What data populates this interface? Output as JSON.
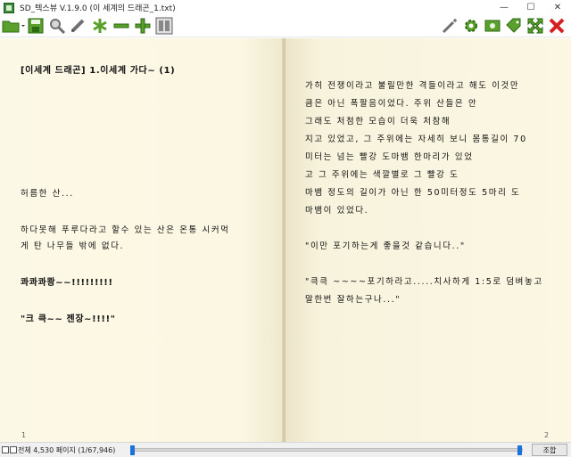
{
  "window": {
    "title": "SD_텍스뷰 V.1.9.0 (이 세계의 드래곤_1.txt)",
    "minimize": "—",
    "maximize": "☐",
    "close": "✕"
  },
  "toolbar": {
    "icons": [
      "open-folder-icon",
      "save-icon",
      "search-icon",
      "pencil-icon",
      "asterisk-icon",
      "minus-icon",
      "plus-icon",
      "two-page-icon",
      "magic-wand-icon",
      "gear-icon",
      "image-icon",
      "tag-icon",
      "fullscreen-icon",
      "exit-icon"
    ],
    "colors": {
      "green": "#5aa02c",
      "gray": "#707070",
      "red": "#d42020"
    }
  },
  "reader": {
    "left_page": {
      "lines": [
        "[이세계 드래곤] 1.이세계 가다~ (1)",
        "허름한 산...",
        "하다못해 푸루다라고 할수 있는 산은 온통 시커먹",
        "게 탄 나무들 밖에 없다.",
        "콰콰콰쾅~~!!!!!!!!!",
        "\"크 큭~~ 젠장~!!!!\""
      ],
      "page_number": "1"
    },
    "right_page": {
      "lines": [
        "가히 전쟁이라고 불릴만한 격들이라고 해도 이것만",
        "큼은 아닌 폭팔음이었다. 주위 산들은 안",
        "그래도 처첨한 모습이 더욱 처참해",
        "지고 있었고, 그 주위에는 자세히 보니 몸통길이 70",
        "미터는 넘는 빨강 도마뱀 한마리가 있었",
        "고 그 주위에는 색깔별로 그 빨강 도",
        "마뱀 정도의 길이가 아닌 한 50미터정도 5마리 도",
        "마뱀이 있었다.",
        "\"이만 포기하는게 좋을것 같습니다..\"",
        "\"큭큭 ~~~~포기하라고.....치사하게 1:5로 덤벼놓고",
        "말한번 잘하는구나...\""
      ],
      "page_number": "2"
    },
    "background": "#fbf7e3"
  },
  "statusbar": {
    "text": "전체 4,530 페이지 (1/67,946)",
    "slider_position": 0.0,
    "combine_label": "조합"
  }
}
